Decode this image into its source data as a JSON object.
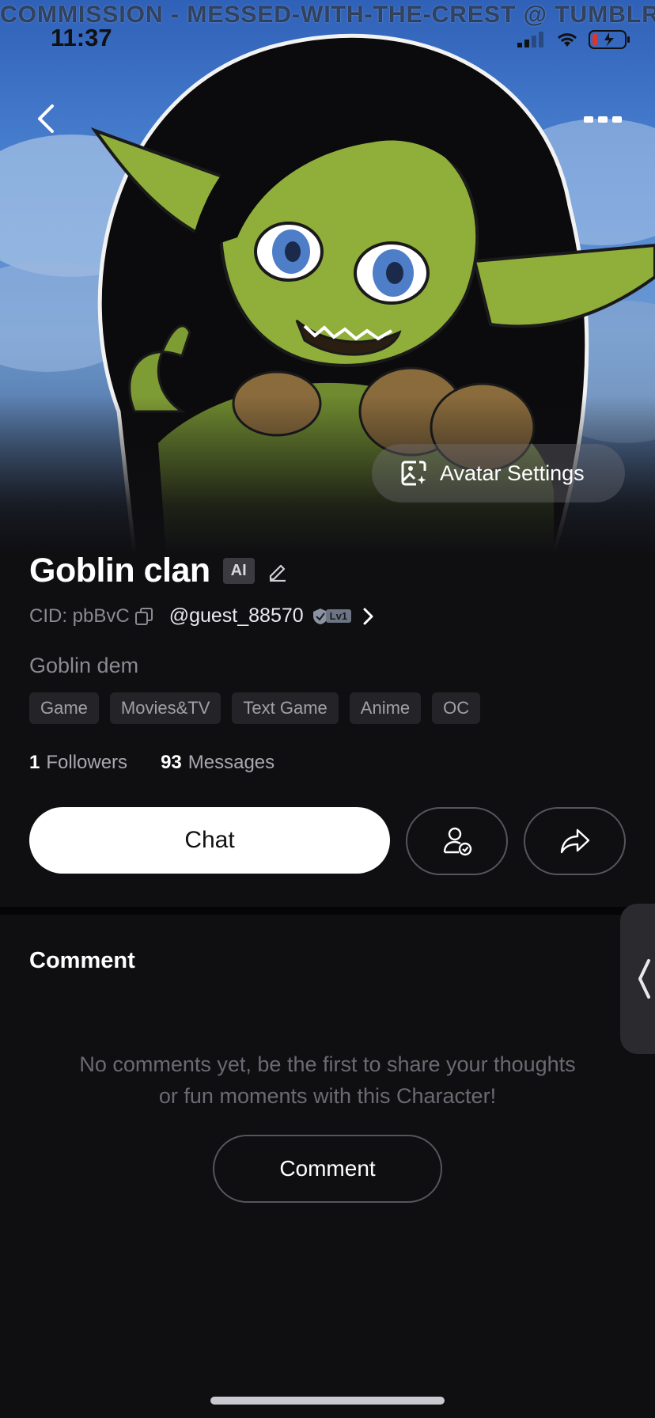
{
  "watermark": "COMMISSION - MESSED-WITH-THE-CREST @ TUMBLR",
  "status_bar": {
    "time": "11:37"
  },
  "hero": {
    "avatar_settings_label": "Avatar Settings"
  },
  "profile": {
    "name": "Goblin clan",
    "ai_badge": "AI",
    "cid": "CID: pbBvC",
    "username": "@guest_88570",
    "level": "Lv1",
    "description": "Goblin dem",
    "tags": [
      "Game",
      "Movies&TV",
      "Text Game",
      "Anime",
      "OC"
    ],
    "followers_count": "1",
    "followers_label": "Followers",
    "messages_count": "93",
    "messages_label": "Messages"
  },
  "actions": {
    "chat_label": "Chat"
  },
  "comments": {
    "title": "Comment",
    "empty_line1": "No comments yet, be the first to share your thoughts",
    "empty_line2": "or fun moments with this Character!",
    "button_label": "Comment"
  },
  "colors": {
    "background": "#0f0f12",
    "chat_button": "#ffffff",
    "skin": "#8fae3a",
    "eyes": "#4f7ec9"
  }
}
